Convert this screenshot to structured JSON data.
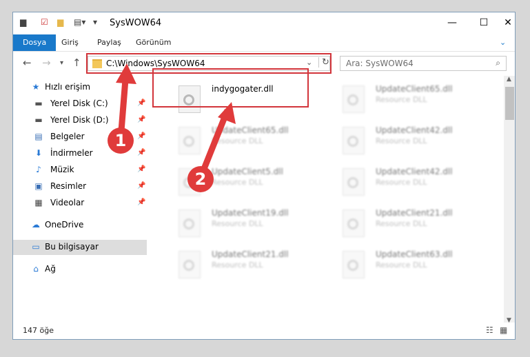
{
  "window": {
    "title": "SysWOW64"
  },
  "ribbon": {
    "tabs": [
      "Dosya",
      "Giriş",
      "Paylaş",
      "Görünüm"
    ]
  },
  "address": {
    "path": "C:\\Windows\\SysWOW64"
  },
  "search": {
    "placeholder": "Ara: SysWOW64"
  },
  "sidebar": {
    "items": [
      {
        "label": "Hızlı erişim",
        "icon": "star-icon"
      },
      {
        "label": "Yerel Disk (C:)",
        "icon": "drive-icon"
      },
      {
        "label": "Yerel Disk (D:)",
        "icon": "drive-icon"
      },
      {
        "label": "Belgeler",
        "icon": "document-icon"
      },
      {
        "label": "İndirmeler",
        "icon": "download-icon"
      },
      {
        "label": "Müzik",
        "icon": "music-icon"
      },
      {
        "label": "Resimler",
        "icon": "pictures-icon"
      },
      {
        "label": "Videolar",
        "icon": "video-icon"
      },
      {
        "label": "OneDrive",
        "icon": "cloud-icon"
      },
      {
        "label": "Bu bilgisayar",
        "icon": "computer-icon"
      },
      {
        "label": "Ağ",
        "icon": "network-icon"
      }
    ]
  },
  "files": [
    {
      "name": "indygogater.dll",
      "sub": ""
    },
    {
      "name": "UpdateClient65.dll",
      "sub": "Resource DLL"
    },
    {
      "name": "UpdateClient65.dll",
      "sub": "Resource DLL"
    },
    {
      "name": "UpdateClient42.dll",
      "sub": "Resource DLL"
    },
    {
      "name": "UpdateClient5.dll",
      "sub": "Resource DLL"
    },
    {
      "name": "UpdateClient42.dll",
      "sub": "Resource DLL"
    },
    {
      "name": "UpdateClient19.dll",
      "sub": "Resource DLL"
    },
    {
      "name": "UpdateClient21.dll",
      "sub": "Resource DLL"
    },
    {
      "name": "UpdateClient21.dll",
      "sub": "Resource DLL"
    },
    {
      "name": "UpdateClient63.dll",
      "sub": "Resource DLL"
    }
  ],
  "status": {
    "count": "147 öğe"
  },
  "callouts": [
    "1",
    "2"
  ],
  "colors": {
    "accent": "#1979ca",
    "highlight": "#d2343a"
  }
}
